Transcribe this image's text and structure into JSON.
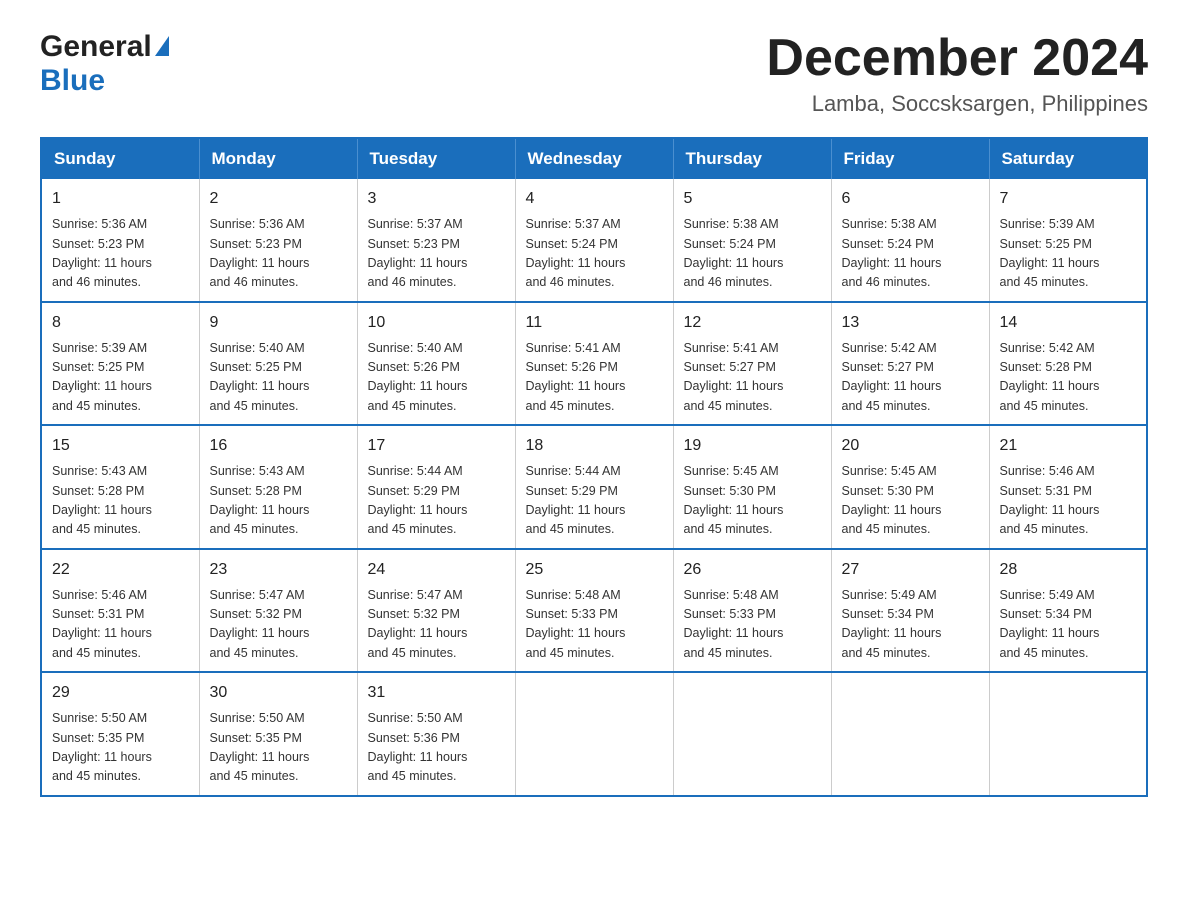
{
  "header": {
    "logo_general": "General",
    "logo_blue": "Blue",
    "month_title": "December 2024",
    "location": "Lamba, Soccsksargen, Philippines"
  },
  "days_of_week": [
    "Sunday",
    "Monday",
    "Tuesday",
    "Wednesday",
    "Thursday",
    "Friday",
    "Saturday"
  ],
  "weeks": [
    [
      {
        "day": "1",
        "sunrise": "5:36 AM",
        "sunset": "5:23 PM",
        "daylight": "11 hours and 46 minutes."
      },
      {
        "day": "2",
        "sunrise": "5:36 AM",
        "sunset": "5:23 PM",
        "daylight": "11 hours and 46 minutes."
      },
      {
        "day": "3",
        "sunrise": "5:37 AM",
        "sunset": "5:23 PM",
        "daylight": "11 hours and 46 minutes."
      },
      {
        "day": "4",
        "sunrise": "5:37 AM",
        "sunset": "5:24 PM",
        "daylight": "11 hours and 46 minutes."
      },
      {
        "day": "5",
        "sunrise": "5:38 AM",
        "sunset": "5:24 PM",
        "daylight": "11 hours and 46 minutes."
      },
      {
        "day": "6",
        "sunrise": "5:38 AM",
        "sunset": "5:24 PM",
        "daylight": "11 hours and 46 minutes."
      },
      {
        "day": "7",
        "sunrise": "5:39 AM",
        "sunset": "5:25 PM",
        "daylight": "11 hours and 45 minutes."
      }
    ],
    [
      {
        "day": "8",
        "sunrise": "5:39 AM",
        "sunset": "5:25 PM",
        "daylight": "11 hours and 45 minutes."
      },
      {
        "day": "9",
        "sunrise": "5:40 AM",
        "sunset": "5:25 PM",
        "daylight": "11 hours and 45 minutes."
      },
      {
        "day": "10",
        "sunrise": "5:40 AM",
        "sunset": "5:26 PM",
        "daylight": "11 hours and 45 minutes."
      },
      {
        "day": "11",
        "sunrise": "5:41 AM",
        "sunset": "5:26 PM",
        "daylight": "11 hours and 45 minutes."
      },
      {
        "day": "12",
        "sunrise": "5:41 AM",
        "sunset": "5:27 PM",
        "daylight": "11 hours and 45 minutes."
      },
      {
        "day": "13",
        "sunrise": "5:42 AM",
        "sunset": "5:27 PM",
        "daylight": "11 hours and 45 minutes."
      },
      {
        "day": "14",
        "sunrise": "5:42 AM",
        "sunset": "5:28 PM",
        "daylight": "11 hours and 45 minutes."
      }
    ],
    [
      {
        "day": "15",
        "sunrise": "5:43 AM",
        "sunset": "5:28 PM",
        "daylight": "11 hours and 45 minutes."
      },
      {
        "day": "16",
        "sunrise": "5:43 AM",
        "sunset": "5:28 PM",
        "daylight": "11 hours and 45 minutes."
      },
      {
        "day": "17",
        "sunrise": "5:44 AM",
        "sunset": "5:29 PM",
        "daylight": "11 hours and 45 minutes."
      },
      {
        "day": "18",
        "sunrise": "5:44 AM",
        "sunset": "5:29 PM",
        "daylight": "11 hours and 45 minutes."
      },
      {
        "day": "19",
        "sunrise": "5:45 AM",
        "sunset": "5:30 PM",
        "daylight": "11 hours and 45 minutes."
      },
      {
        "day": "20",
        "sunrise": "5:45 AM",
        "sunset": "5:30 PM",
        "daylight": "11 hours and 45 minutes."
      },
      {
        "day": "21",
        "sunrise": "5:46 AM",
        "sunset": "5:31 PM",
        "daylight": "11 hours and 45 minutes."
      }
    ],
    [
      {
        "day": "22",
        "sunrise": "5:46 AM",
        "sunset": "5:31 PM",
        "daylight": "11 hours and 45 minutes."
      },
      {
        "day": "23",
        "sunrise": "5:47 AM",
        "sunset": "5:32 PM",
        "daylight": "11 hours and 45 minutes."
      },
      {
        "day": "24",
        "sunrise": "5:47 AM",
        "sunset": "5:32 PM",
        "daylight": "11 hours and 45 minutes."
      },
      {
        "day": "25",
        "sunrise": "5:48 AM",
        "sunset": "5:33 PM",
        "daylight": "11 hours and 45 minutes."
      },
      {
        "day": "26",
        "sunrise": "5:48 AM",
        "sunset": "5:33 PM",
        "daylight": "11 hours and 45 minutes."
      },
      {
        "day": "27",
        "sunrise": "5:49 AM",
        "sunset": "5:34 PM",
        "daylight": "11 hours and 45 minutes."
      },
      {
        "day": "28",
        "sunrise": "5:49 AM",
        "sunset": "5:34 PM",
        "daylight": "11 hours and 45 minutes."
      }
    ],
    [
      {
        "day": "29",
        "sunrise": "5:50 AM",
        "sunset": "5:35 PM",
        "daylight": "11 hours and 45 minutes."
      },
      {
        "day": "30",
        "sunrise": "5:50 AM",
        "sunset": "5:35 PM",
        "daylight": "11 hours and 45 minutes."
      },
      {
        "day": "31",
        "sunrise": "5:50 AM",
        "sunset": "5:36 PM",
        "daylight": "11 hours and 45 minutes."
      },
      null,
      null,
      null,
      null
    ]
  ],
  "labels": {
    "sunrise": "Sunrise:",
    "sunset": "Sunset:",
    "daylight": "Daylight:"
  }
}
